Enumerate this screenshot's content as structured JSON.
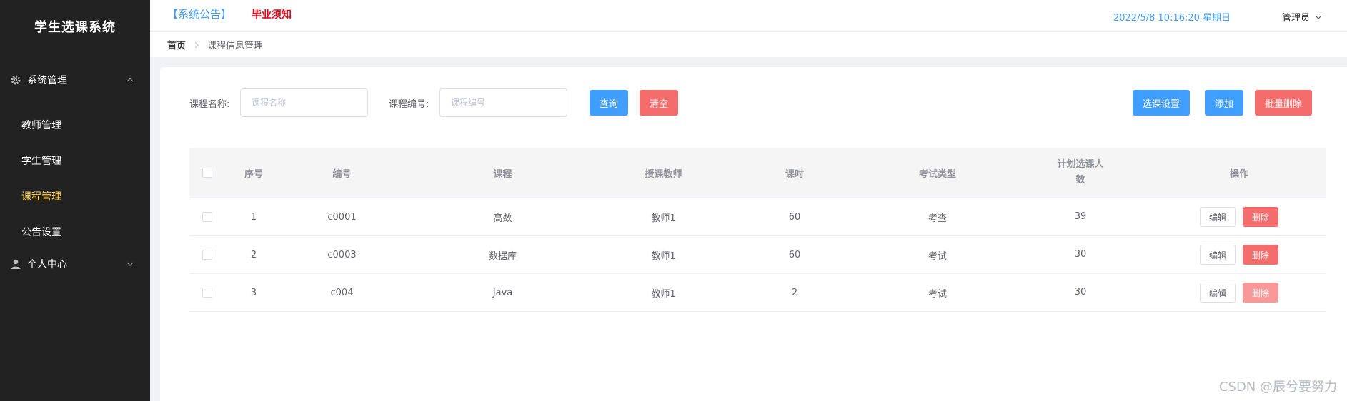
{
  "app": {
    "title": "学生选课系统"
  },
  "colors": {
    "accent": "#409eff",
    "danger": "#f56c6c",
    "sidebar_bg": "#222222",
    "active_menu": "#ffd04b",
    "notice_red": "#e60012"
  },
  "sidebar": {
    "groups": [
      {
        "label": "系统管理",
        "icon": "gear-icon",
        "expanded": true,
        "items": [
          {
            "label": "教师管理"
          },
          {
            "label": "学生管理"
          },
          {
            "label": "课程管理",
            "active": true
          },
          {
            "label": "公告设置"
          }
        ]
      },
      {
        "label": "个人中心",
        "icon": "user-icon",
        "expanded": false,
        "items": []
      }
    ]
  },
  "header": {
    "notice_tag": "【系统公告】",
    "notice_text": "毕业须知",
    "datetime": "2022/5/8 10:16:20 星期日",
    "user_label": "管理员"
  },
  "breadcrumb": {
    "home": "首页",
    "current": "课程信息管理"
  },
  "search": {
    "name_label": "课程名称:",
    "name_placeholder": "课程名称",
    "name_value": "",
    "code_label": "课程编号:",
    "code_placeholder": "课程编号",
    "code_value": "",
    "query_label": "查询",
    "clear_label": "清空"
  },
  "toolbar": {
    "settings_label": "选课设置",
    "add_label": "添加",
    "batch_delete_label": "批量删除"
  },
  "table": {
    "columns": [
      "序号",
      "编号",
      "课程",
      "授课教师",
      "课时",
      "考试类型",
      "计划选课人数",
      "操作"
    ],
    "rows": [
      {
        "index": "1",
        "code": "c0001",
        "course": "高数",
        "teacher": "教师1",
        "hours": "60",
        "exam": "考查",
        "plan": "39"
      },
      {
        "index": "2",
        "code": "c0003",
        "course": "数据库",
        "teacher": "教师1",
        "hours": "60",
        "exam": "考试",
        "plan": "30"
      },
      {
        "index": "3",
        "code": "c004",
        "course": "Java",
        "teacher": "教师1",
        "hours": "2",
        "exam": "考试",
        "plan": "30"
      }
    ],
    "edit_label": "编辑",
    "delete_label": "删除"
  },
  "watermark": "CSDN @辰兮要努力"
}
